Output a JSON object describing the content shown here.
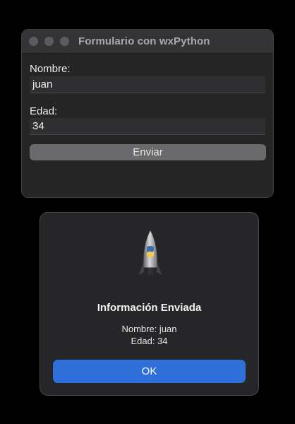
{
  "window": {
    "title": "Formulario con wxPython",
    "controls": [
      "close-button",
      "minimize-button",
      "zoom-button"
    ]
  },
  "form": {
    "name_label": "Nombre:",
    "name_value": "juan",
    "age_label": "Edad:",
    "age_value": "34",
    "submit_label": "Enviar"
  },
  "alert": {
    "icon": "python-rocket-icon",
    "title": "Información Enviada",
    "line1": "Nombre: juan",
    "line2": "Edad: 34",
    "ok_label": "OK"
  },
  "colors": {
    "background": "#000000",
    "window": "#252526",
    "accent": "#2f6fd9"
  }
}
